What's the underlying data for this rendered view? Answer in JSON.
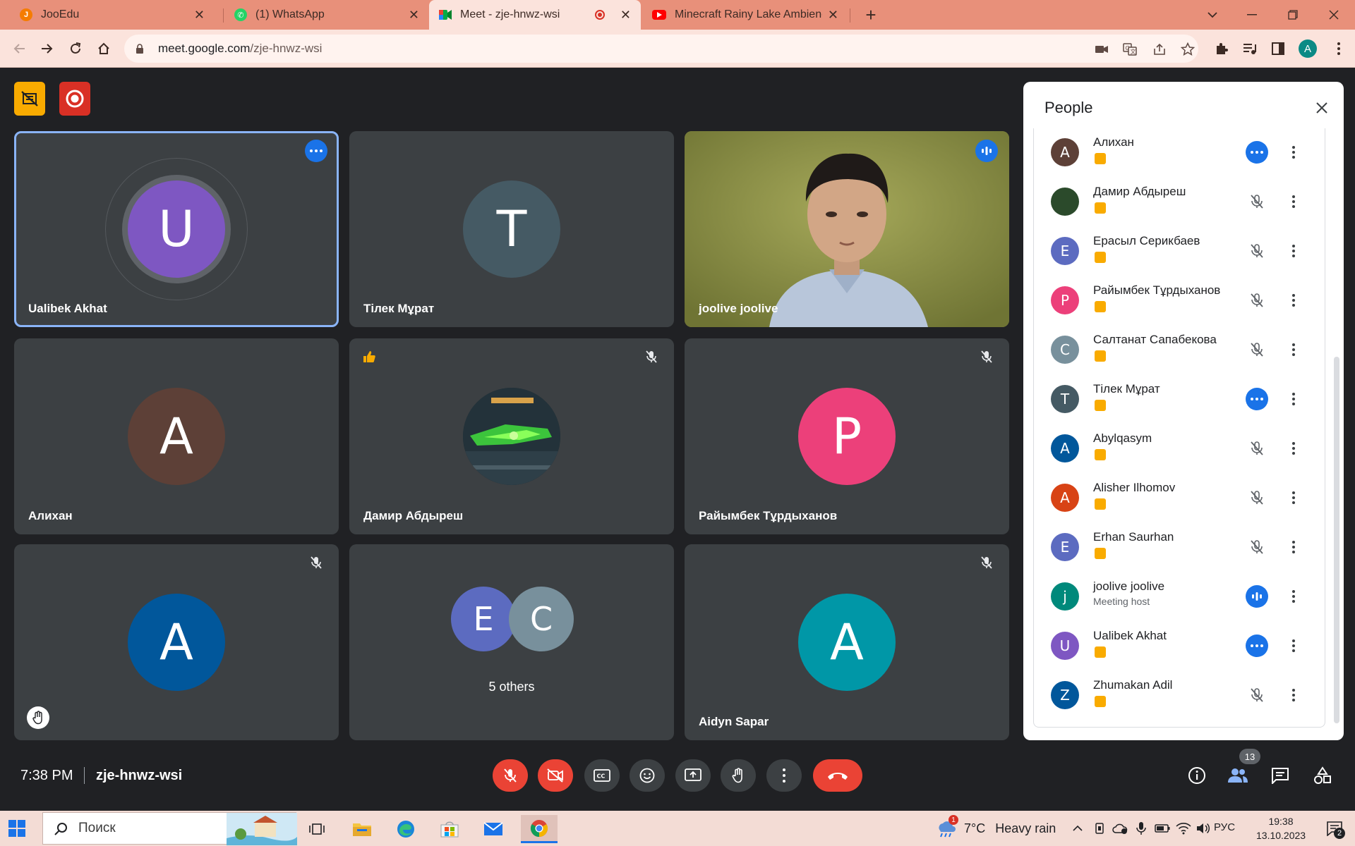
{
  "browser": {
    "tabs": [
      {
        "title": "JooEdu",
        "active": false
      },
      {
        "title": "(1) WhatsApp",
        "active": false
      },
      {
        "title": "Meet - zje-hnwz-wsi",
        "active": true
      },
      {
        "title": "Minecraft Rainy Lake Ambience (",
        "active": false
      }
    ],
    "new_tab": "+",
    "url_host": "meet.google.com",
    "url_path": "/zje-hnwz-wsi",
    "profile_initial": "A"
  },
  "tiles": [
    {
      "name": "Ualibek Akhat",
      "initial": "U",
      "color": "#7e57c2",
      "status": "more"
    },
    {
      "name": "Тілек Мұрат",
      "initial": "T",
      "color": "#455a64",
      "status": ""
    },
    {
      "name": "joolive joolive",
      "initial": "",
      "color": "",
      "status": "speaking"
    },
    {
      "name": "Алихан",
      "initial": "A",
      "color": "#5d4037",
      "status": ""
    },
    {
      "name": "Дамир Абдыреш",
      "initial": "",
      "color": "",
      "status": "muted"
    },
    {
      "name": "Райымбек Тұрдыханов",
      "initial": "P",
      "color": "#ec407a",
      "status": "muted"
    },
    {
      "name": "",
      "initial": "A",
      "color": "#01579b",
      "status": "muted"
    },
    {
      "name": "5 others",
      "initials": [
        "E",
        "C"
      ],
      "colors": [
        "#5c6bc0",
        "#78909c"
      ]
    },
    {
      "name": "Aidyn Sapar",
      "initial": "A",
      "color": "#0097a7",
      "status": "muted"
    }
  ],
  "people_panel": {
    "title": "People",
    "list": [
      {
        "name": "Алихан",
        "initial": "A",
        "color": "#5d4037",
        "status": "more",
        "sub": ""
      },
      {
        "name": "Дамир Абдыреш",
        "initial": "",
        "color": "#2b4a2b",
        "status": "muted",
        "sub": ""
      },
      {
        "name": "Ерасыл Серикбаев",
        "initial": "E",
        "color": "#5c6bc0",
        "status": "muted",
        "sub": ""
      },
      {
        "name": "Райымбек Тұрдыханов",
        "initial": "P",
        "color": "#ec407a",
        "status": "muted",
        "sub": ""
      },
      {
        "name": "Салтанат Сапабекова",
        "initial": "C",
        "color": "#78909c",
        "status": "muted",
        "sub": ""
      },
      {
        "name": "Тілек Мұрат",
        "initial": "T",
        "color": "#455a64",
        "status": "more",
        "sub": ""
      },
      {
        "name": "Abylqasym",
        "initial": "A",
        "color": "#01579b",
        "status": "muted",
        "sub": ""
      },
      {
        "name": "Alisher Ilhomov",
        "initial": "A",
        "color": "#d84315",
        "status": "muted",
        "sub": ""
      },
      {
        "name": "Erhan Saurhan",
        "initial": "E",
        "color": "#5c6bc0",
        "status": "muted",
        "sub": ""
      },
      {
        "name": "joolive joolive",
        "initial": "j",
        "color": "#00897b",
        "status": "speaking",
        "sub": "Meeting host"
      },
      {
        "name": "Ualibek Akhat",
        "initial": "U",
        "color": "#7e57c2",
        "status": "more",
        "sub": ""
      },
      {
        "name": "Zhumakan Adil",
        "initial": "Z",
        "color": "#01579b",
        "status": "muted",
        "sub": ""
      }
    ]
  },
  "controls": {
    "time": "7:38 PM",
    "meeting_code": "zje-hnwz-wsi",
    "participants_count": "13"
  },
  "taskbar": {
    "search_placeholder": "Поиск",
    "weather_temp": "7°C",
    "weather_desc": "Heavy rain",
    "weather_alert": "1",
    "language": "РУС",
    "clock_time": "19:38",
    "clock_date": "13.10.2023",
    "notif_count": "2"
  },
  "colors": {
    "meet_bg": "#202124",
    "tile_bg": "#3c4043",
    "accent_blue": "#1a73e8",
    "end_call_red": "#ea4335",
    "tab_bar": "#e8907a"
  }
}
